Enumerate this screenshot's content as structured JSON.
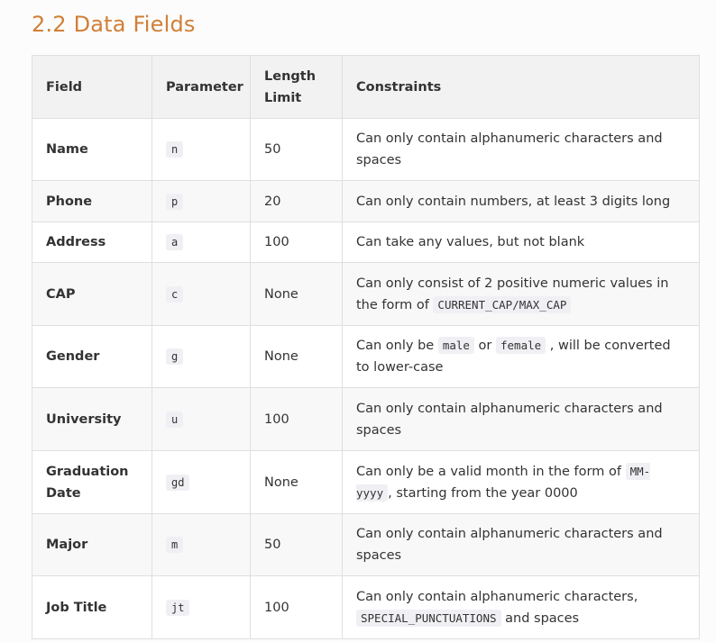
{
  "title": "2.2 Data Fields",
  "table": {
    "headers": [
      "Field",
      "Parameter",
      "Length Limit",
      "Constraints"
    ],
    "rows": [
      {
        "field": "Name",
        "parameter": "n",
        "length": "50",
        "constraints": {
          "text": "Can only contain alphanumeric characters and spaces"
        }
      },
      {
        "field": "Phone",
        "parameter": "p",
        "length": "20",
        "constraints": {
          "text": "Can only contain numbers, at least 3 digits long"
        }
      },
      {
        "field": "Address",
        "parameter": "a",
        "length": "100",
        "constraints": {
          "text": "Can take any values, but not blank"
        }
      },
      {
        "field": "CAP",
        "parameter": "c",
        "length": "None",
        "constraints": {
          "text_before": "Can only consist of 2 positive numeric values in the form of",
          "code": "CURRENT_CAP/MAX_CAP"
        }
      },
      {
        "field": "Gender",
        "parameter": "g",
        "length": "None",
        "constraints": {
          "text_1": "Can only be",
          "code_1": "male",
          "text_2": "or",
          "code_2": "female",
          "text_3": ", will be converted to lower-case"
        }
      },
      {
        "field": "University",
        "parameter": "u",
        "length": "100",
        "constraints": {
          "text": "Can only contain alphanumeric characters and spaces"
        }
      },
      {
        "field": "Graduation Date",
        "parameter": "gd",
        "length": "None",
        "constraints": {
          "text_before": "Can only be a valid month in the form of",
          "code": "MM-yyyy",
          "text_after": ", starting from the year 0000"
        }
      },
      {
        "field": "Major",
        "parameter": "m",
        "length": "50",
        "constraints": {
          "text": "Can only contain alphanumeric characters and spaces"
        }
      },
      {
        "field": "Job Title",
        "parameter": "jt",
        "length": "100",
        "constraints": {
          "text_before": "Can only contain alphanumeric characters,",
          "code": "SPECIAL_PUNCTUATIONS",
          "text_after": "and spaces"
        }
      }
    ]
  }
}
